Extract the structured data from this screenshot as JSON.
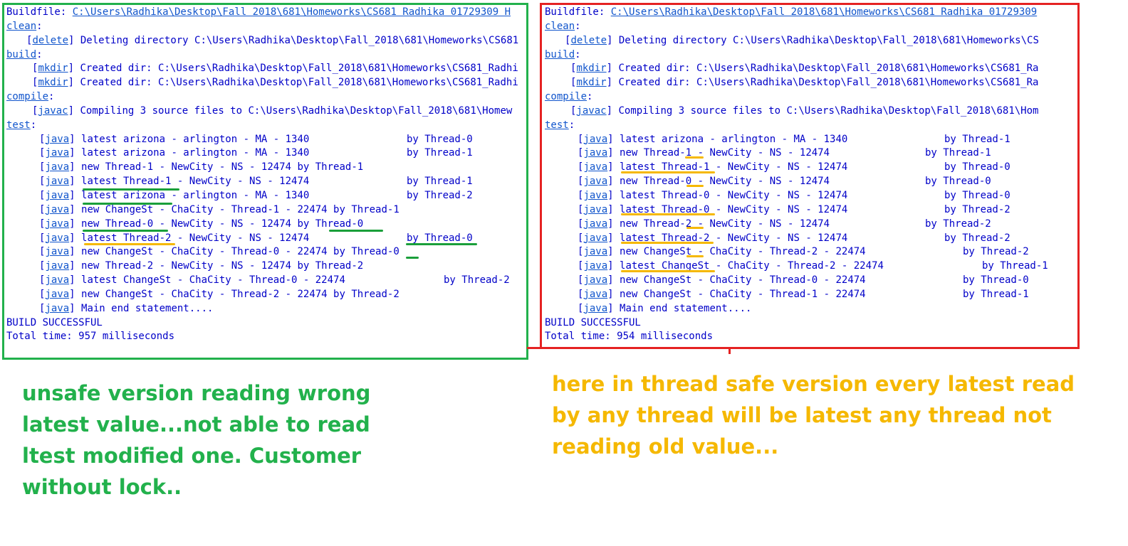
{
  "colors": {
    "console_text": "#0000c8",
    "link": "#1155cc",
    "green_frame": "#22b14c",
    "red_frame": "#e52222",
    "green_note": "#22b14c",
    "orange_note": "#f5b800"
  },
  "left": {
    "buildfile_label": "Buildfile: ",
    "buildfile_path": "C:\\Users\\Radhika\\Desktop\\Fall 2018\\681\\Homeworks\\CS681 Radhika 01729309 H",
    "clean_target": "clean",
    "delete_tag": "delete",
    "delete_msg": " Deleting directory C:\\Users\\Radhika\\Desktop\\Fall_2018\\681\\Homeworks\\CS681",
    "build_target": "build",
    "mkdir_tag": "mkdir",
    "mkdir_msg1": " Created dir: C:\\Users\\Radhika\\Desktop\\Fall_2018\\681\\Homeworks\\CS681_Radhi",
    "mkdir_msg2": " Created dir: C:\\Users\\Radhika\\Desktop\\Fall_2018\\681\\Homeworks\\CS681_Radhi",
    "compile_target": "compile",
    "javac_tag": "javac",
    "javac_msg": " Compiling 3 source files to C:\\Users\\Radhika\\Desktop\\Fall_2018\\681\\Homew",
    "test_target": "test",
    "java_tag": "java",
    "java_lines": [
      {
        "text": " latest arizona - arlington - MA - 1340",
        "by": "by Thread-0"
      },
      {
        "text": " latest arizona - arlington - MA - 1340",
        "by": "by Thread-1"
      },
      {
        "text": " new Thread-1 - NewCity - NS - 12474 by Thread-1",
        "by": ""
      },
      {
        "text": " latest Thread-1 - NewCity - NS - 12474",
        "by": "by Thread-1"
      },
      {
        "text": " latest arizona - arlington - MA - 1340",
        "by": "by Thread-2"
      },
      {
        "text": " new ChangeSt - ChaCity - Thread-1 - 22474 by Thread-1",
        "by": ""
      },
      {
        "text": " new Thread-0 - NewCity - NS - 12474 by Thread-0",
        "by": ""
      },
      {
        "text": " latest Thread-2 - NewCity - NS - 12474",
        "by": "by Thread-0"
      },
      {
        "text": " new ChangeSt - ChaCity - Thread-0 - 22474 by Thread-0",
        "by": ""
      },
      {
        "text": " new Thread-2 - NewCity - NS - 12474 by Thread-2",
        "by": ""
      },
      {
        "text": " latest ChangeSt - ChaCity - Thread-0 - 22474",
        "by": "by Thread-2"
      },
      {
        "text": " new ChangeSt - ChaCity - Thread-2 - 22474 by Thread-2",
        "by": ""
      },
      {
        "text": " Main end statement....",
        "by": ""
      }
    ],
    "build_result": "BUILD SUCCESSFUL",
    "total_time": "Total time: 957 milliseconds"
  },
  "right": {
    "buildfile_label": "Buildfile: ",
    "buildfile_path": "C:\\Users\\Radhika\\Desktop\\Fall 2018\\681\\Homeworks\\CS681 Radhika 01729309",
    "clean_target": "clean",
    "delete_tag": "delete",
    "delete_msg": " Deleting directory C:\\Users\\Radhika\\Desktop\\Fall_2018\\681\\Homeworks\\CS",
    "build_target": "build",
    "mkdir_tag": "mkdir",
    "mkdir_msg1": " Created dir: C:\\Users\\Radhika\\Desktop\\Fall_2018\\681\\Homeworks\\CS681_Ra",
    "mkdir_msg2": " Created dir: C:\\Users\\Radhika\\Desktop\\Fall_2018\\681\\Homeworks\\CS681_Ra",
    "compile_target": "compile",
    "javac_tag": "javac",
    "javac_msg": " Compiling 3 source files to C:\\Users\\Radhika\\Desktop\\Fall_2018\\681\\Hom",
    "test_target": "test",
    "java_tag": "java",
    "java_lines": [
      {
        "text": " latest arizona - arlington - MA - 1340",
        "by": "by Thread-1"
      },
      {
        "text": " new Thread-1 - NewCity - NS - 12474",
        "by": "by Thread-1"
      },
      {
        "text": " latest Thread-1 - NewCity - NS - 12474",
        "by": "by Thread-0"
      },
      {
        "text": " new Thread-0 - NewCity - NS - 12474",
        "by": "by Thread-0"
      },
      {
        "text": " latest Thread-0 - NewCity - NS - 12474",
        "by": "by Thread-0"
      },
      {
        "text": " latest Thread-0 - NewCity - NS - 12474",
        "by": "by Thread-2"
      },
      {
        "text": " new Thread-2 - NewCity - NS - 12474",
        "by": "by Thread-2"
      },
      {
        "text": " latest Thread-2 - NewCity - NS - 12474",
        "by": "by Thread-2"
      },
      {
        "text": " new ChangeSt - ChaCity - Thread-2 - 22474",
        "by": "by Thread-2"
      },
      {
        "text": " latest ChangeSt - ChaCity - Thread-2 - 22474",
        "by": "by Thread-1"
      },
      {
        "text": " new ChangeSt - ChaCity - Thread-0 - 22474",
        "by": "by Thread-0"
      },
      {
        "text": " new ChangeSt - ChaCity - Thread-1 - 22474",
        "by": "by Thread-1"
      },
      {
        "text": " Main end statement....",
        "by": ""
      }
    ],
    "build_result": "BUILD SUCCESSFUL",
    "total_time": "Total time: 954 milliseconds"
  },
  "notes": {
    "green": "unsafe version reading wrong\nlatest value...not able to read\nltest modified one. Customer\nwithout lock..",
    "orange": "here in thread safe version every latest read\nby any thread will be latest any thread not\nreading old value..."
  }
}
